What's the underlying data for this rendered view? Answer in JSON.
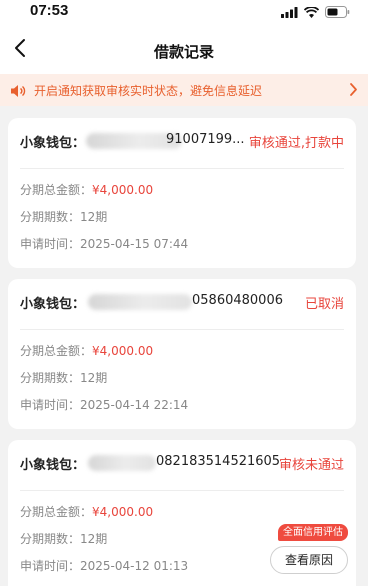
{
  "status_bar": {
    "time": "07:53"
  },
  "nav": {
    "title": "借款记录"
  },
  "notice": {
    "text": "开启通知获取审核实时状态，避免信息延迟"
  },
  "labels": {
    "wallet": "小象钱包：",
    "total_amount": "分期总金额：",
    "periods": "分期期数：",
    "apply_time": "申请时间："
  },
  "records": [
    {
      "order_no": "91007199...",
      "status": "审核通过,打款中",
      "amount": "¥4,000.00",
      "periods": "12期",
      "apply_time": "2025-04-15 07:44"
    },
    {
      "order_no": "05860480006",
      "status": "已取消",
      "amount": "¥4,000.00",
      "periods": "12期",
      "apply_time": "2025-04-14 22:14"
    },
    {
      "order_no": "082183514521605",
      "status": "审核未通过",
      "amount": "¥4,000.00",
      "periods": "12期",
      "apply_time": "2025-04-12 01:13",
      "badge": "全面信用评估",
      "action": "查看原因"
    }
  ]
}
